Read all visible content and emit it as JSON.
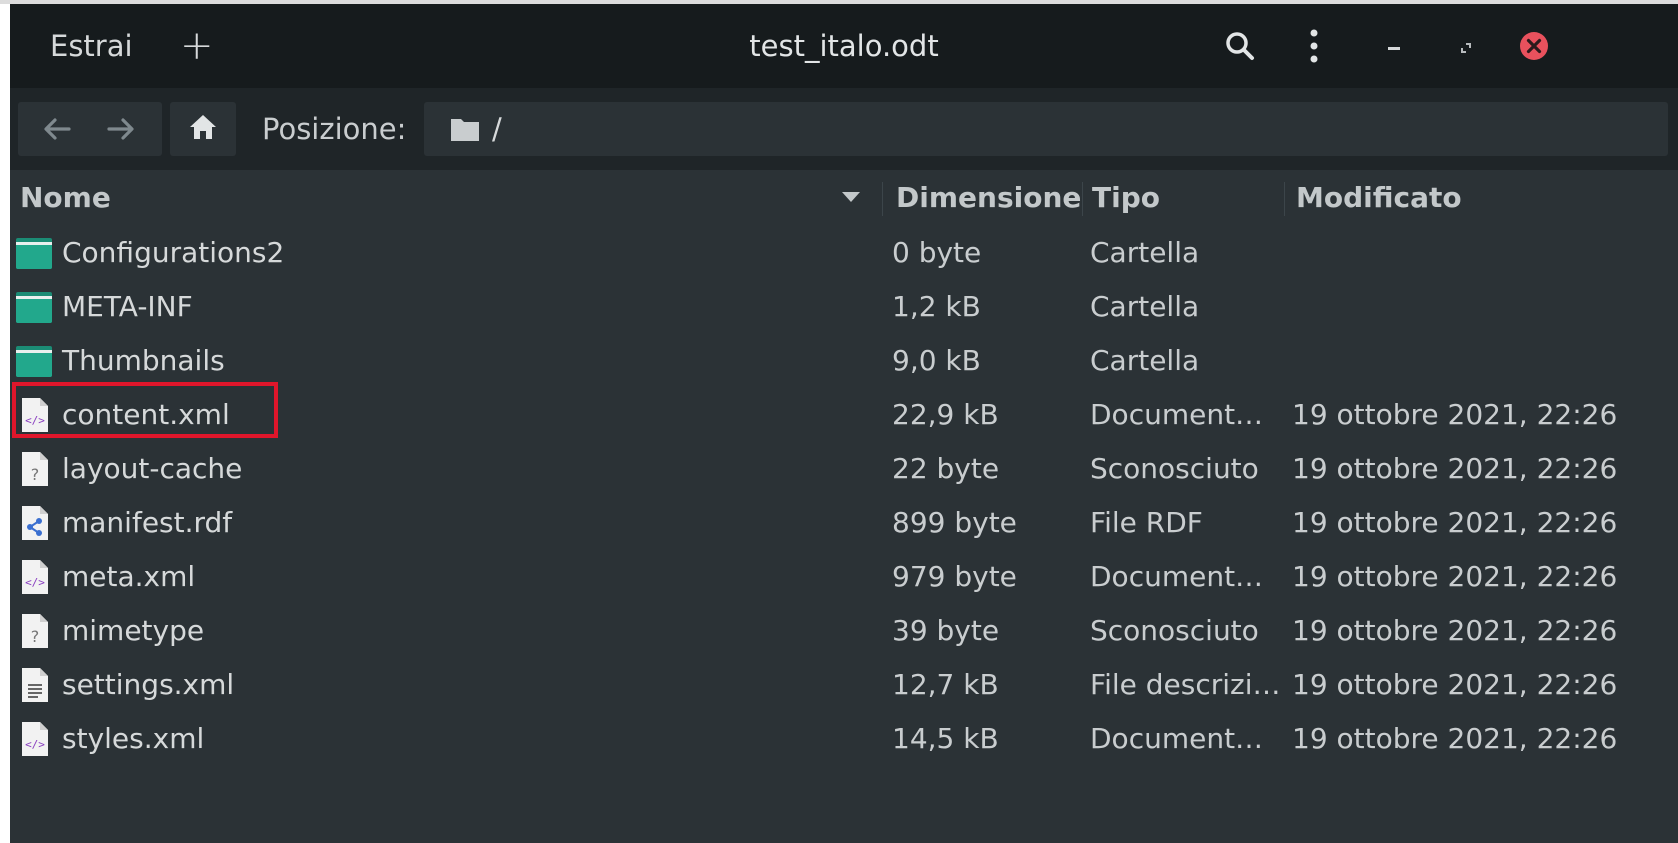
{
  "header": {
    "extract_label": "Estrai",
    "add_label": "+",
    "title": "test_italo.odt"
  },
  "location_bar": {
    "label": "Posizione:",
    "path": "/"
  },
  "columns": {
    "name": "Nome",
    "size": "Dimensione",
    "type": "Tipo",
    "modified": "Modificato"
  },
  "files": [
    {
      "name": "Configurations2",
      "size": "0 byte",
      "type": "Cartella",
      "modified": "",
      "icon": "folder-icon"
    },
    {
      "name": "META-INF",
      "size": "1,2 kB",
      "type": "Cartella",
      "modified": "",
      "icon": "folder-icon"
    },
    {
      "name": "Thumbnails",
      "size": "9,0 kB",
      "type": "Cartella",
      "modified": "",
      "icon": "folder-icon"
    },
    {
      "name": "content.xml",
      "size": "22,9 kB",
      "type": "Document…",
      "modified": "19 ottobre 2021, 22:26",
      "icon": "xml-file-icon"
    },
    {
      "name": "layout-cache",
      "size": "22 byte",
      "type": "Sconosciuto",
      "modified": "19 ottobre 2021, 22:26",
      "icon": "unknown-file-icon"
    },
    {
      "name": "manifest.rdf",
      "size": "899 byte",
      "type": "File RDF",
      "modified": "19 ottobre 2021, 22:26",
      "icon": "rdf-file-icon"
    },
    {
      "name": "meta.xml",
      "size": "979 byte",
      "type": "Document…",
      "modified": "19 ottobre 2021, 22:26",
      "icon": "xml-file-icon"
    },
    {
      "name": "mimetype",
      "size": "39 byte",
      "type": "Sconosciuto",
      "modified": "19 ottobre 2021, 22:26",
      "icon": "unknown-file-icon"
    },
    {
      "name": "settings.xml",
      "size": "12,7 kB",
      "type": "File descrizi…",
      "modified": "19 ottobre 2021, 22:26",
      "icon": "text-file-icon"
    },
    {
      "name": "styles.xml",
      "size": "14,5 kB",
      "type": "Document…",
      "modified": "19 ottobre 2021, 22:26",
      "icon": "xml-file-icon"
    }
  ],
  "colors": {
    "window_bg": "#2b3236",
    "headerbar_bg": "#161b1d",
    "folder": "#1f9c82",
    "highlight": "#e0162b",
    "close_button": "#e8515d"
  }
}
